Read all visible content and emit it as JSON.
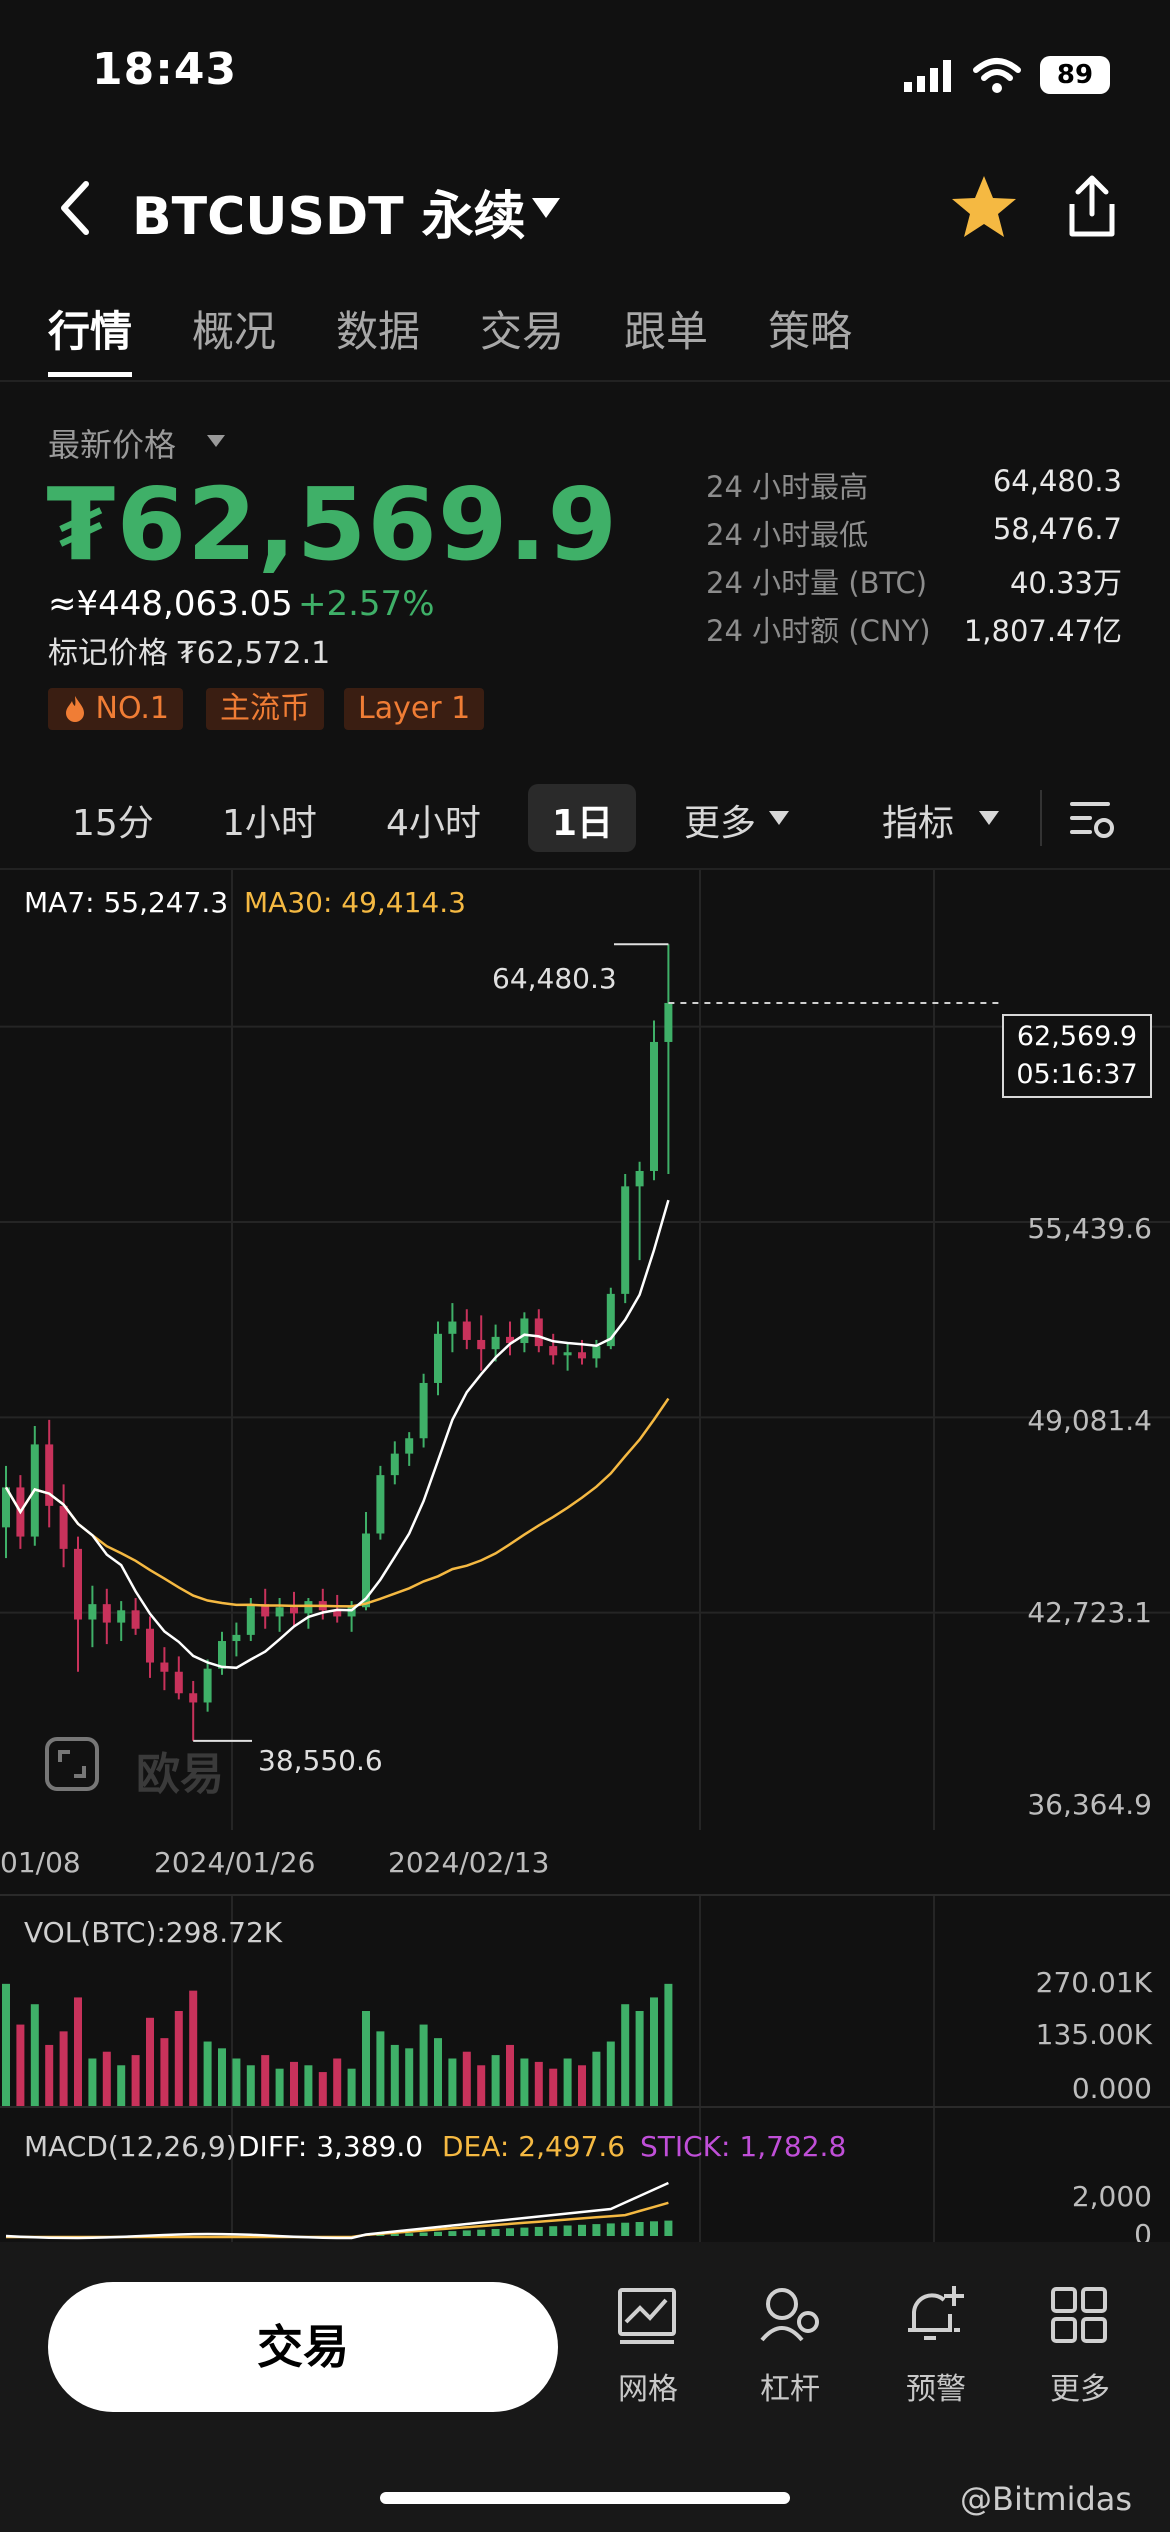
{
  "status_bar": {
    "time": "18:43",
    "battery": "89"
  },
  "header": {
    "title": "BTCUSDT 永续"
  },
  "tabs": [
    "行情",
    "概况",
    "数据",
    "交易",
    "跟单",
    "策略"
  ],
  "price": {
    "latest_label": "最新价格",
    "last": "₮62,569.9",
    "cny": "≈¥448,063.05",
    "change": "+2.57%",
    "mark": "标记价格 ₮62,572.1"
  },
  "tags": [
    "NO.1",
    "主流币",
    "Layer 1"
  ],
  "stats": [
    {
      "label": "24 小时最高",
      "value": "64,480.3"
    },
    {
      "label": "24 小时最低",
      "value": "58,476.7"
    },
    {
      "label": "24 小时量 (BTC)",
      "value": "40.33万"
    },
    {
      "label": "24 小时额 (CNY)",
      "value": "1,807.47亿"
    }
  ],
  "timeframes": [
    "15分",
    "1小时",
    "4小时",
    "1日",
    "更多",
    "指标"
  ],
  "chart": {
    "ma7": "MA7: 55,247.3",
    "ma30": "MA30: 49,414.3",
    "high_marker": "64,480.3",
    "low_marker": "38,550.6",
    "current_price": "62,569.9",
    "countdown": "05:16:37",
    "watermark": "欧易",
    "y_ticks": [
      "55,439.6",
      "49,081.4",
      "42,723.1",
      "36,364.9"
    ],
    "x_ticks": [
      "01/08",
      "2024/01/26",
      "2024/02/13"
    ],
    "vol_label": "VOL(BTC):298.72K",
    "vol_ticks": [
      "270.01K",
      "135.00K",
      "0.000"
    ],
    "macd_label": "MACD(12,26,9)",
    "diff": "DIFF: 3,389.0",
    "dea": "DEA: 2,497.6",
    "stick": "STICK: 1,782.8",
    "macd_ticks": [
      "2,000",
      "0"
    ],
    "colors": {
      "up": "#3fb068",
      "down": "#c8325b",
      "ma7": "#ffffff",
      "ma30": "#f5b942",
      "stick": "#c04fd8"
    }
  },
  "chart_data": {
    "type": "candlestick",
    "x_ticks": [
      "01/08",
      "2024/01/26",
      "2024/02/13"
    ],
    "ylim": [
      36364.9,
      67000
    ],
    "y_ticks": [
      55439.6,
      49081.4,
      42723.1,
      36364.9
    ],
    "candles": [
      [
        45500,
        47500,
        44500,
        46800
      ],
      [
        46800,
        47200,
        44800,
        45200
      ],
      [
        45200,
        48800,
        44900,
        48200
      ],
      [
        48200,
        49000,
        45500,
        46200
      ],
      [
        46200,
        46900,
        44200,
        44800
      ],
      [
        44800,
        45200,
        40800,
        42500
      ],
      [
        42500,
        43600,
        41600,
        43000
      ],
      [
        43000,
        43500,
        41700,
        42400
      ],
      [
        42400,
        43100,
        41800,
        42800
      ],
      [
        42800,
        43200,
        42000,
        42200
      ],
      [
        42200,
        42600,
        40600,
        41100
      ],
      [
        41100,
        41600,
        40200,
        40800
      ],
      [
        40800,
        41300,
        39900,
        40100
      ],
      [
        40100,
        40500,
        38550.6,
        39800
      ],
      [
        39800,
        41200,
        39500,
        40900
      ],
      [
        40900,
        42100,
        40700,
        41800
      ],
      [
        41800,
        42400,
        41300,
        42000
      ],
      [
        42000,
        43200,
        41800,
        43000
      ],
      [
        43000,
        43500,
        42200,
        42600
      ],
      [
        42600,
        43200,
        42100,
        42900
      ],
      [
        42900,
        43400,
        42300,
        42700
      ],
      [
        42700,
        43200,
        42200,
        43100
      ],
      [
        43100,
        43500,
        42500,
        42800
      ],
      [
        42800,
        43300,
        42400,
        42600
      ],
      [
        42600,
        43100,
        42100,
        42900
      ],
      [
        42900,
        46000,
        42800,
        45300
      ],
      [
        45300,
        47500,
        45100,
        47200
      ],
      [
        47200,
        48300,
        46900,
        47900
      ],
      [
        47900,
        48600,
        47500,
        48400
      ],
      [
        48400,
        50500,
        48100,
        50200
      ],
      [
        50200,
        52200,
        49800,
        51800
      ],
      [
        51800,
        52800,
        51200,
        52200
      ],
      [
        52200,
        52600,
        51300,
        51600
      ],
      [
        51600,
        52400,
        50600,
        51300
      ],
      [
        51300,
        52100,
        50900,
        51700
      ],
      [
        51700,
        52200,
        51100,
        51500
      ],
      [
        51500,
        52500,
        51200,
        52300
      ],
      [
        52300,
        52600,
        51200,
        51400
      ],
      [
        51400,
        51800,
        50800,
        51100
      ],
      [
        51100,
        51500,
        50600,
        51200
      ],
      [
        51200,
        51600,
        50800,
        51000
      ],
      [
        51000,
        51600,
        50700,
        51400
      ],
      [
        51400,
        53300,
        51300,
        53100
      ],
      [
        53100,
        57000,
        52800,
        56600
      ],
      [
        56600,
        57400,
        54200,
        57100
      ],
      [
        57100,
        62000,
        56800,
        61300
      ],
      [
        61300,
        64480.3,
        57000,
        62569.9
      ]
    ],
    "ma7_last": 55247.3,
    "ma30_last": 49414.3,
    "current_price": 62569.9
  }
}
